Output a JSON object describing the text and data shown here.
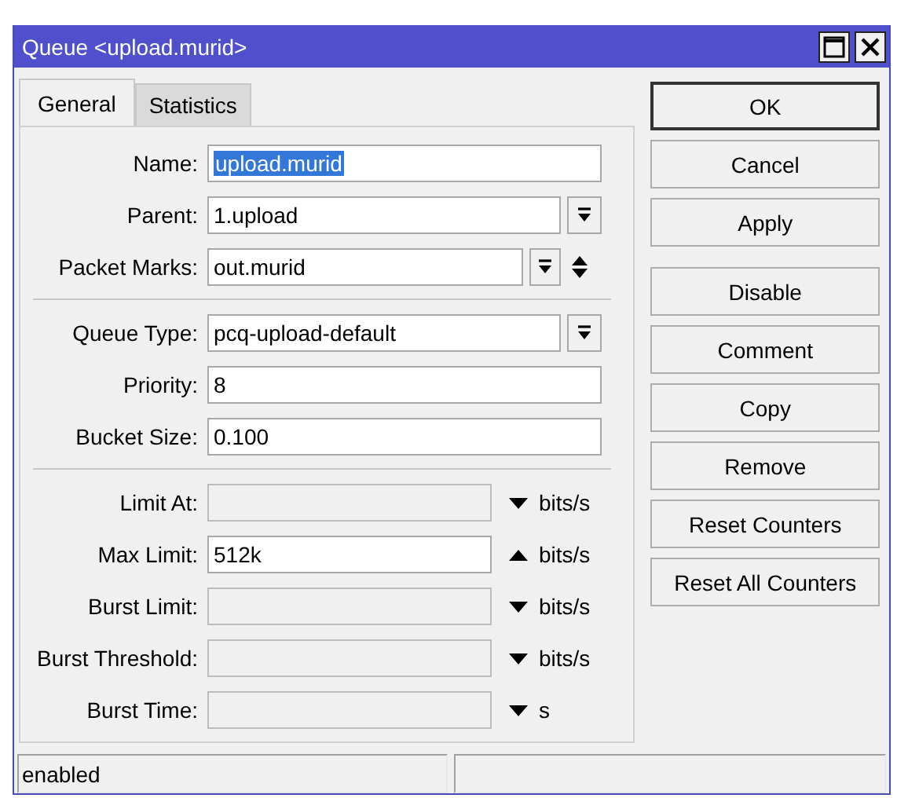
{
  "window": {
    "title": "Queue <upload.murid>"
  },
  "tabs": [
    {
      "label": "General",
      "selected": true
    },
    {
      "label": "Statistics",
      "selected": false
    }
  ],
  "sections": [
    {
      "rows": [
        {
          "kind": "text",
          "label": "Name:",
          "value": "upload.murid",
          "highlighted": true
        },
        {
          "kind": "dropdown",
          "label": "Parent:",
          "value": "1.upload",
          "highlighted": false
        },
        {
          "kind": "multi",
          "label": "Packet Marks:",
          "value": "out.murid",
          "highlighted": false
        }
      ]
    },
    {
      "rows": [
        {
          "kind": "dropdown",
          "label": "Queue Type:",
          "value": "pcq-upload-default",
          "highlighted": false
        },
        {
          "kind": "text",
          "label": "Priority:",
          "value": "8",
          "highlighted": false
        },
        {
          "kind": "text",
          "label": "Bucket Size:",
          "value": "0.100",
          "highlighted": false
        }
      ]
    },
    {
      "rows": [
        {
          "kind": "limit",
          "label": "Limit At:",
          "disabled": true,
          "expanded": false,
          "unit": "bits/s"
        },
        {
          "kind": "limit",
          "label": "Max Limit:",
          "value": "512k",
          "disabled": false,
          "expanded": true,
          "unit": "bits/s"
        },
        {
          "kind": "limit",
          "label": "Burst Limit:",
          "disabled": true,
          "expanded": false,
          "unit": "bits/s"
        },
        {
          "kind": "limit",
          "label": "Burst Threshold:",
          "disabled": true,
          "expanded": false,
          "unit": "bits/s"
        },
        {
          "kind": "limit",
          "label": "Burst Time:",
          "disabled": true,
          "expanded": false,
          "unit": "s"
        }
      ]
    }
  ],
  "button_groups": [
    [
      {
        "label": "OK",
        "default": true
      },
      {
        "label": "Cancel",
        "default": false
      },
      {
        "label": "Apply",
        "default": false
      }
    ],
    [
      {
        "label": "Disable",
        "default": false
      },
      {
        "label": "Comment",
        "default": false
      },
      {
        "label": "Copy",
        "default": false
      },
      {
        "label": "Remove",
        "default": false
      },
      {
        "label": "Reset Counters",
        "default": false
      },
      {
        "label": "Reset All Counters",
        "default": false
      }
    ]
  ],
  "status_bar": {
    "status": "enabled"
  }
}
